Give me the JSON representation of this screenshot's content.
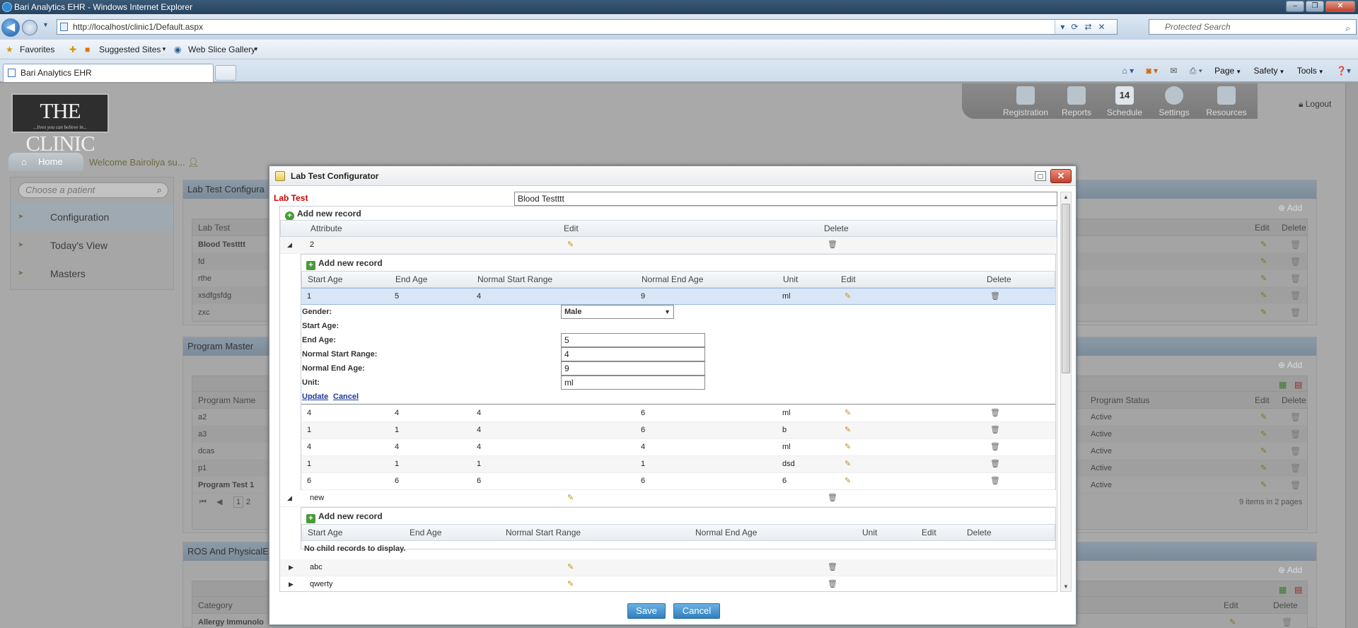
{
  "browser": {
    "window_title": "Bari Analytics EHR - Windows Internet Explorer",
    "url": "http://localhost/clinic1/Default.aspx",
    "search_placeholder": "Protected Search",
    "favorites": {
      "favorites_label": "Favorites",
      "suggested_sites": "Suggested Sites",
      "web_slice_gallery": "Web Slice Gallery"
    },
    "tab_title": "Bari Analytics EHR",
    "commands": [
      "Page",
      "Safety",
      "Tools"
    ]
  },
  "app": {
    "logo_text": "THE CLINIC",
    "logo_tagline": "...lives you can believe in...",
    "top_nav": [
      "Registration",
      "Reports",
      "Schedule",
      "Settings",
      "Resources"
    ],
    "schedule_day": "14",
    "logout": "Logout",
    "home_tab": "Home",
    "welcome": "Welcome Bairoliya su...",
    "patient_placeholder": "Choose a patient",
    "left_nav": [
      "Configuration",
      "Today's View",
      "Masters"
    ],
    "panels": {
      "lab_test": {
        "title": "Lab Test Configura",
        "add": "Add",
        "headers": [
          "Lab Test",
          "Edit",
          "Delete"
        ],
        "rows": [
          "Blood Testttt",
          "fd",
          "rthe",
          "xsdfgsfdg",
          "zxc"
        ]
      },
      "program_master": {
        "title": "Program Master",
        "add": "Add",
        "headers": [
          "Program Name",
          "Program Status",
          "Edit",
          "Delete"
        ],
        "rows": [
          {
            "name": "a2",
            "status": "Active"
          },
          {
            "name": "a3",
            "status": "Active"
          },
          {
            "name": "dcas",
            "status": "Active"
          },
          {
            "name": "p1",
            "status": "Active"
          },
          {
            "name": "Program Test 1",
            "status": "Active"
          }
        ],
        "pager_pages": [
          "1",
          "2"
        ],
        "pager_info": "9 items in 2 pages"
      },
      "ros": {
        "title": "ROS And PhysicalE",
        "add": "Add",
        "headers": [
          "Category",
          "Edit",
          "Delete"
        ],
        "rows": [
          "Allergy Immunolo"
        ]
      }
    }
  },
  "dialog": {
    "title": "Lab Test Configurator",
    "lab_test_label": "Lab Test",
    "lab_test_value": "Blood Testttt",
    "add_new_record": "Add new record",
    "attr_headers": [
      "Attribute",
      "Edit",
      "Delete"
    ],
    "child_headers": [
      "Start Age",
      "End Age",
      "Normal Start Range",
      "Normal End Age",
      "Unit",
      "Edit",
      "Delete"
    ],
    "attributes": [
      {
        "name": "2"
      },
      {
        "name": "new"
      },
      {
        "name": "abc"
      },
      {
        "name": "qwerty"
      }
    ],
    "selected_row": {
      "start_age": "1",
      "end_age": "5",
      "normal_start": "4",
      "normal_end": "9",
      "unit": "ml"
    },
    "edit_form": {
      "gender_label": "Gender:",
      "gender_value": "Male",
      "start_age_label": "Start Age:",
      "end_age_label": "End Age:",
      "end_age_value": "5",
      "normal_start_label": "Normal Start Range:",
      "normal_start_value": "4",
      "normal_end_label": "Normal End Age:",
      "normal_end_value": "9",
      "unit_label": "Unit:",
      "unit_value": "ml",
      "update": "Update",
      "cancel": "Cancel"
    },
    "child_rows": [
      {
        "start_age": "4",
        "end_age": "4",
        "normal_start": "4",
        "normal_end": "6",
        "unit": "ml"
      },
      {
        "start_age": "1",
        "end_age": "1",
        "normal_start": "4",
        "normal_end": "6",
        "unit": "b"
      },
      {
        "start_age": "4",
        "end_age": "4",
        "normal_start": "4",
        "normal_end": "4",
        "unit": "ml"
      },
      {
        "start_age": "1",
        "end_age": "1",
        "normal_start": "1",
        "normal_end": "1",
        "unit": "dsd"
      },
      {
        "start_age": "6",
        "end_age": "6",
        "normal_start": "6",
        "normal_end": "6",
        "unit": "6"
      }
    ],
    "no_child_records": "No child records to display.",
    "save": "Save",
    "cancel": "Cancel"
  }
}
